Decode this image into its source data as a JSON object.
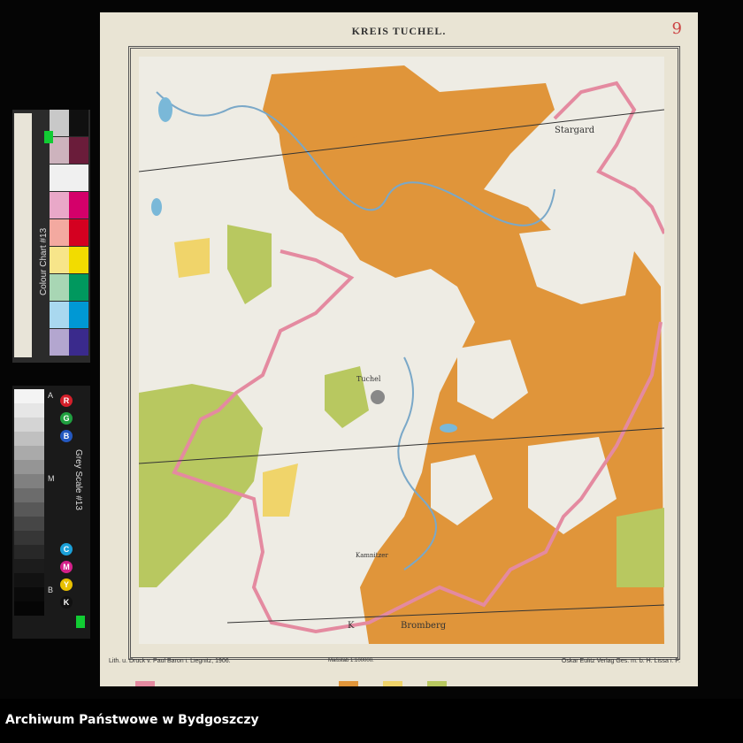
{
  "colour_chart": {
    "label": "Colour Chart #13",
    "colors": [
      "#c8c8c8",
      "#101010",
      "#cdb3bd",
      "#6a1c3a",
      "#f0f0f0",
      "#f0f0f0",
      "#e9a8c8",
      "#d4006a",
      "#f3a9a0",
      "#d40020",
      "#f7e58a",
      "#f2dc00",
      "#a8d6b4",
      "#00985e",
      "#a9d8ef",
      "#0098d4",
      "#b3a6cf",
      "#3a2a8c"
    ]
  },
  "grey_scale": {
    "label": "Grey Scale #13",
    "letters": [
      "A",
      "M",
      "B"
    ],
    "dots": [
      "R",
      "G",
      "B",
      "C",
      "M",
      "Y",
      "K"
    ],
    "dot_colors": [
      "#d41f2a",
      "#20a040",
      "#2458c0",
      "#1aa0d8",
      "#d4208a",
      "#e8c000",
      "#111111"
    ]
  },
  "map": {
    "title": "KREIS TUCHEL.",
    "stamp": "9",
    "labels": [
      "Stargard",
      "Tuchel",
      "Kamnitzer",
      "Bromberg",
      "K"
    ],
    "footer_left": "Lith. u. Druck v. Paul Baron i. Liegnitz, 1906.",
    "footer_right": "Oskar Eulitz Verlag Ges. m. b. H. Lissa i. P.",
    "scale": "Maßstab 1:100000.",
    "legend_colors": [
      "#e0953a",
      "#f0d46a",
      "#b8c860",
      "#e48aa0"
    ]
  },
  "archive": {
    "name": "Archiwum Państwowe w Bydgoszczy"
  }
}
